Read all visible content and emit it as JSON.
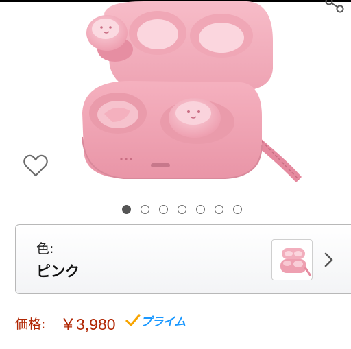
{
  "product": {
    "image_icon": "pink-wireless-earbuds-case-image",
    "image_index": 1,
    "image_count": 7
  },
  "actions": {
    "share_icon": "share-icon",
    "wishlist_icon": "heart-icon"
  },
  "variant": {
    "label": "色:",
    "value": "ピンク",
    "thumbnail_icon": "pink-earbuds-thumbnail",
    "chevron_icon": "chevron-right-icon"
  },
  "price": {
    "label": "価格:",
    "value": "￥3,980",
    "prime_badge": "プライム",
    "prime_icon": "prime-check-icon"
  },
  "colors": {
    "price": "#b12704",
    "prime": "#1a98ff",
    "product_pink": "#f2a5b4"
  }
}
